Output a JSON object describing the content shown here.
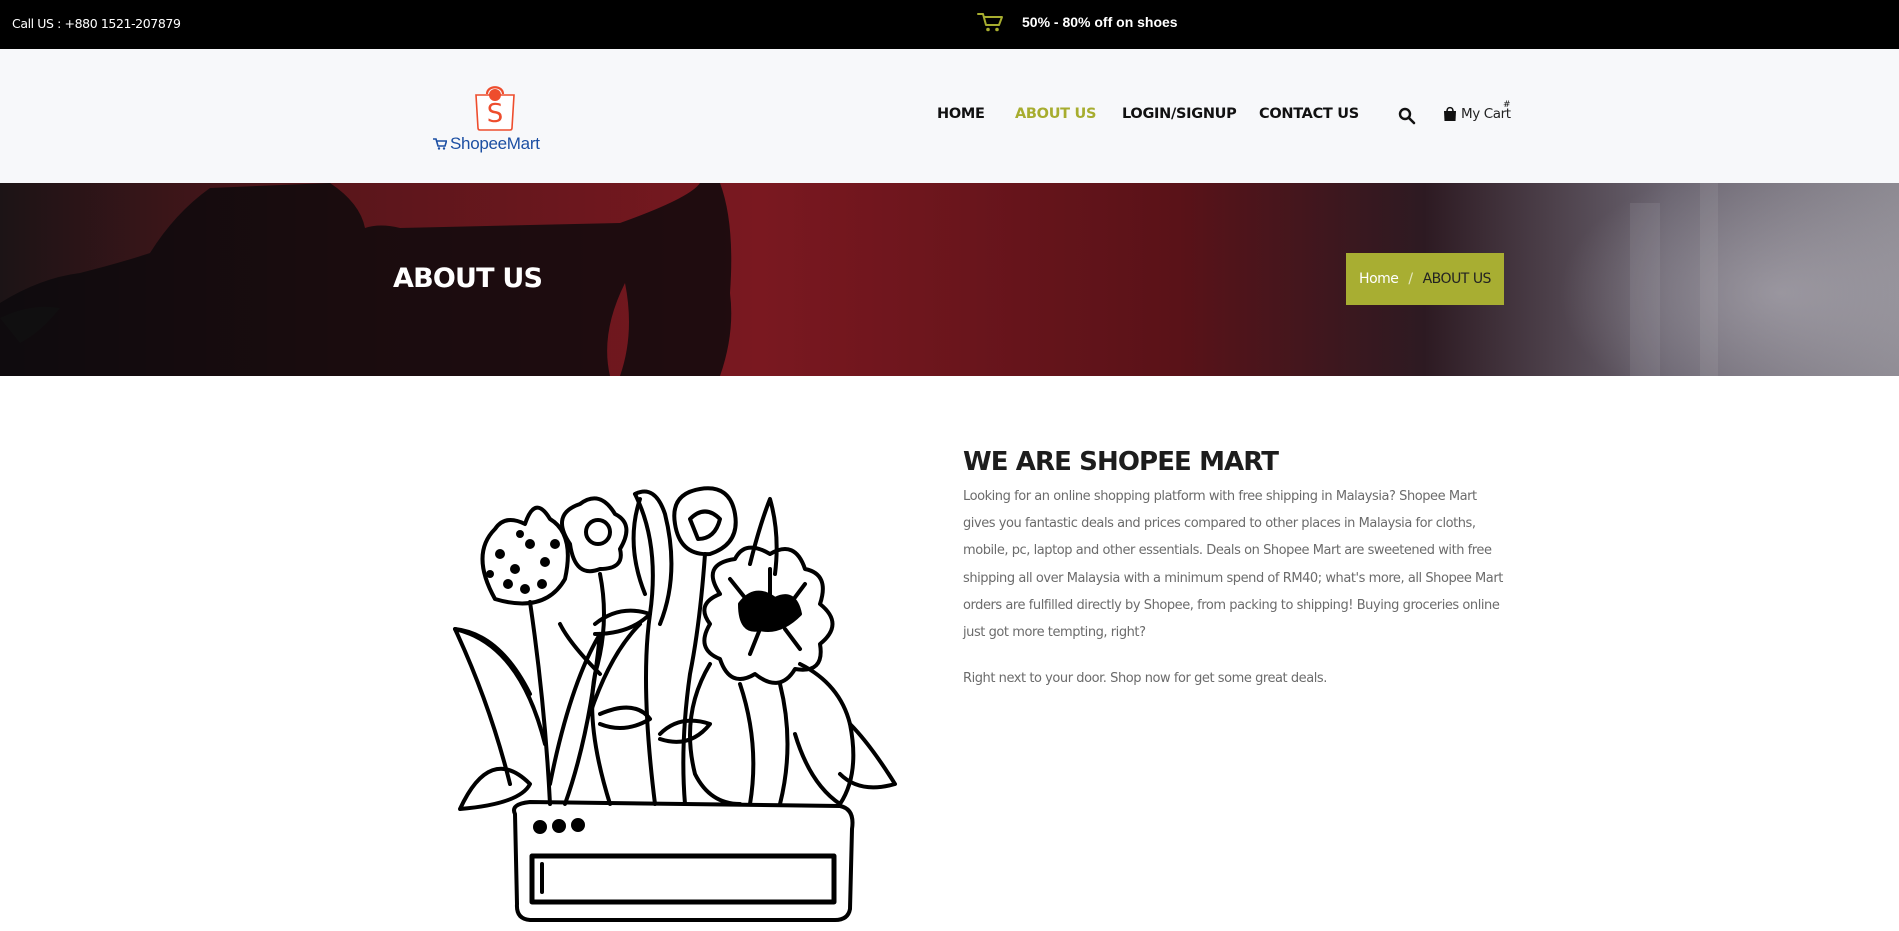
{
  "topbar": {
    "call": "Call US : +880 1521-207879",
    "promo": "50% - 80% off on shoes",
    "promo_icon": "shopping-cart-icon",
    "promo_icon_color": "#a7ad2f"
  },
  "header": {
    "logo": {
      "brand_text": "ShopeeMart",
      "bag_letter": "S",
      "brand_color": "#1c4fa3",
      "bag_color": "#ee4d2d"
    },
    "nav": [
      {
        "label": "HOME",
        "active": false
      },
      {
        "label": "ABOUT US",
        "active": true
      },
      {
        "label": "LOGIN/SIGNUP",
        "active": false
      },
      {
        "label": "CONTACT US",
        "active": false
      }
    ],
    "search_icon": "search-icon",
    "cart": {
      "label": "My Cart",
      "count": "#",
      "icon": "shopping-bag-icon"
    }
  },
  "banner": {
    "title": "ABOUT US",
    "breadcrumb": {
      "home": "Home",
      "separator": "/",
      "current": "ABOUT US"
    },
    "accent": "#a8ae32"
  },
  "about": {
    "heading": "WE ARE SHOPEE MART",
    "intro": "Looking for an online shopping platform with free shipping in Malaysia? Shopee Mart gives you fantastic deals and prices compared to other places in Malaysia for cloths, mobile, pc, laptop and other essentials. Deals on Shopee Mart are sweetened with free shipping all over Malaysia with a minimum spend of RM40; what's more, all Shopee Mart orders are fulfilled directly by Shopee, from packing to shipping! Buying groceries online just got more tempting, right?",
    "second": "Right next to your door. Shop now for get some great deals.",
    "illustration": "flower-planter-illustration"
  }
}
